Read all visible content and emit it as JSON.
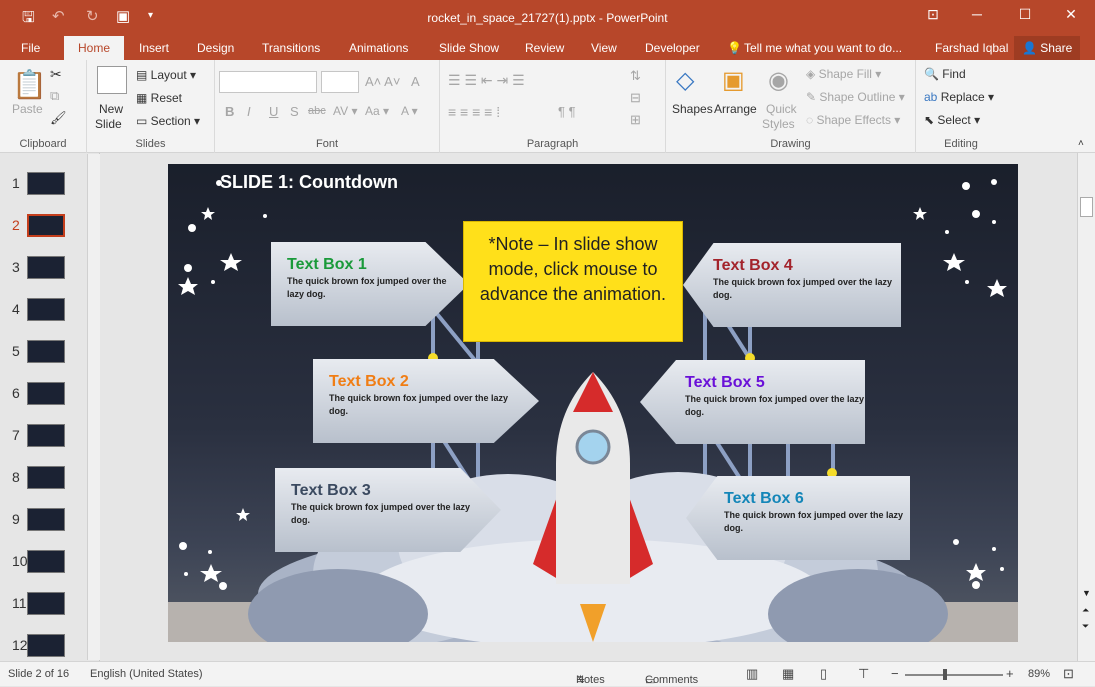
{
  "window": {
    "title": "rocket_in_space_21727(1).pptx - PowerPoint"
  },
  "tabs": {
    "file": "File",
    "home": "Home",
    "insert": "Insert",
    "design": "Design",
    "transitions": "Transitions",
    "animations": "Animations",
    "slideshow": "Slide Show",
    "review": "Review",
    "view": "View",
    "developer": "Developer",
    "tellme": "Tell me what you want to do...",
    "user": "Farshad Iqbal",
    "share": "Share"
  },
  "ribbon": {
    "clipboard": {
      "label": "Clipboard",
      "paste": "Paste"
    },
    "slides": {
      "label": "Slides",
      "new_slide": "New",
      "new_slide2": "Slide",
      "layout": "Layout",
      "reset": "Reset",
      "section": "Section"
    },
    "font": {
      "label": "Font",
      "bold": "B",
      "italic": "I",
      "underline": "U",
      "strike": "S",
      "shadow": "abc"
    },
    "paragraph": {
      "label": "Paragraph"
    },
    "drawing": {
      "label": "Drawing",
      "shapes": "Shapes",
      "arrange": "Arrange",
      "quick": "Quick",
      "styles": "Styles",
      "fill": "Shape Fill",
      "outline": "Shape Outline",
      "effects": "Shape Effects"
    },
    "editing": {
      "label": "Editing",
      "find": "Find",
      "replace": "Replace",
      "select": "Select"
    }
  },
  "thumbnails": [
    "1",
    "2",
    "3",
    "4",
    "5",
    "6",
    "7",
    "8",
    "9",
    "10",
    "11",
    "12"
  ],
  "slide": {
    "title": "SLIDE 1: Countdown",
    "note": "*Note – In slide show mode, click mouse to advance the animation.",
    "boxes": [
      {
        "title": "Text Box 1",
        "body": "The quick brown fox jumped over the lazy dog.",
        "color": "#1a9a3a"
      },
      {
        "title": "Text Box 2",
        "body": "The quick brown fox jumped over the lazy dog.",
        "color": "#f07d14"
      },
      {
        "title": "Text Box 3",
        "body": "The quick brown fox jumped over the lazy dog.",
        "color": "#3b4a60"
      },
      {
        "title": "Text Box 4",
        "body": "The quick brown fox jumped over the lazy dog.",
        "color": "#a3232b"
      },
      {
        "title": "Text Box 5",
        "body": "The quick brown fox jumped over the lazy dog.",
        "color": "#6a10d8"
      },
      {
        "title": "Text Box 6",
        "body": "The quick brown fox jumped over the lazy dog.",
        "color": "#1486b8"
      }
    ]
  },
  "status": {
    "slide": "Slide 2 of 16",
    "language": "English (United States)",
    "notes": "Notes",
    "comments": "Comments",
    "zoom": "89%"
  }
}
